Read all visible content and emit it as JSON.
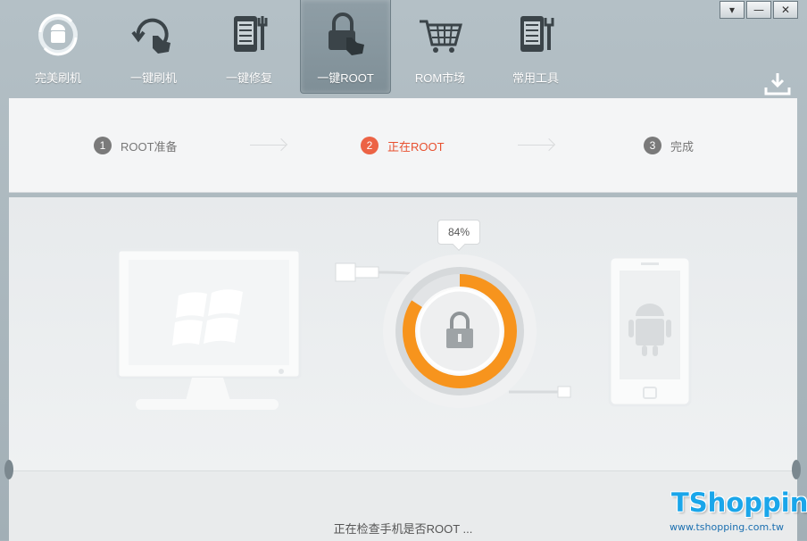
{
  "toolbar": {
    "items": [
      {
        "label": "完美刷机",
        "icon": "android-refresh-icon",
        "active": false
      },
      {
        "label": "一键刷机",
        "icon": "refresh-hand-icon",
        "active": false
      },
      {
        "label": "一键修复",
        "icon": "phone-wrench-icon",
        "active": false
      },
      {
        "label": "一键ROOT",
        "icon": "lock-hand-icon",
        "active": true
      },
      {
        "label": "ROM市场",
        "icon": "shopping-cart-icon",
        "active": false
      },
      {
        "label": "常用工具",
        "icon": "toolbox-icon",
        "active": false
      }
    ],
    "window_buttons": [
      "▾",
      "—",
      "✕"
    ]
  },
  "steps": {
    "items": [
      {
        "num": "1",
        "label": "ROOT准备"
      },
      {
        "num": "2",
        "label": "正在ROOT"
      },
      {
        "num": "3",
        "label": "完成"
      }
    ],
    "active_index": 1
  },
  "progress": {
    "percent_label": "84%",
    "value": 0.84
  },
  "status_text": "正在检查手机是否ROOT ...",
  "watermark": {
    "title": "TShopping",
    "url": "www.tshopping.com.tw"
  },
  "colors": {
    "accent": "#ec6345",
    "ring": "#f7941d",
    "toolbar_bg": "#a9b6bd"
  }
}
